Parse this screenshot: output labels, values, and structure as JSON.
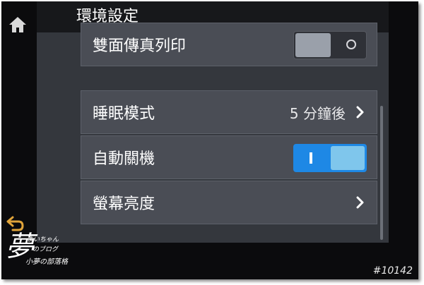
{
  "title": "環境設定",
  "settings": [
    {
      "label": "雙面傳真列印",
      "toggle": "off"
    },
    {
      "label": "睡眠模式",
      "value": "5 分鐘後"
    },
    {
      "label": "自動關機",
      "toggle": "on"
    },
    {
      "label": "螢幕亮度"
    }
  ],
  "icons": {
    "home": "home-icon",
    "back": "back-arrow-icon",
    "chevron": "chevron-right-icon"
  },
  "watermark": {
    "big": "夢",
    "line1": "まいちゃん",
    "line2": "のブログ",
    "line3": "小夢の部落格"
  },
  "photo_id": "#10142",
  "colors": {
    "accent": "#1e88e5",
    "toggle_on_knob": "#7fc6ec",
    "row_bg": "#4a4d55",
    "screen_bg": "#34373d"
  }
}
